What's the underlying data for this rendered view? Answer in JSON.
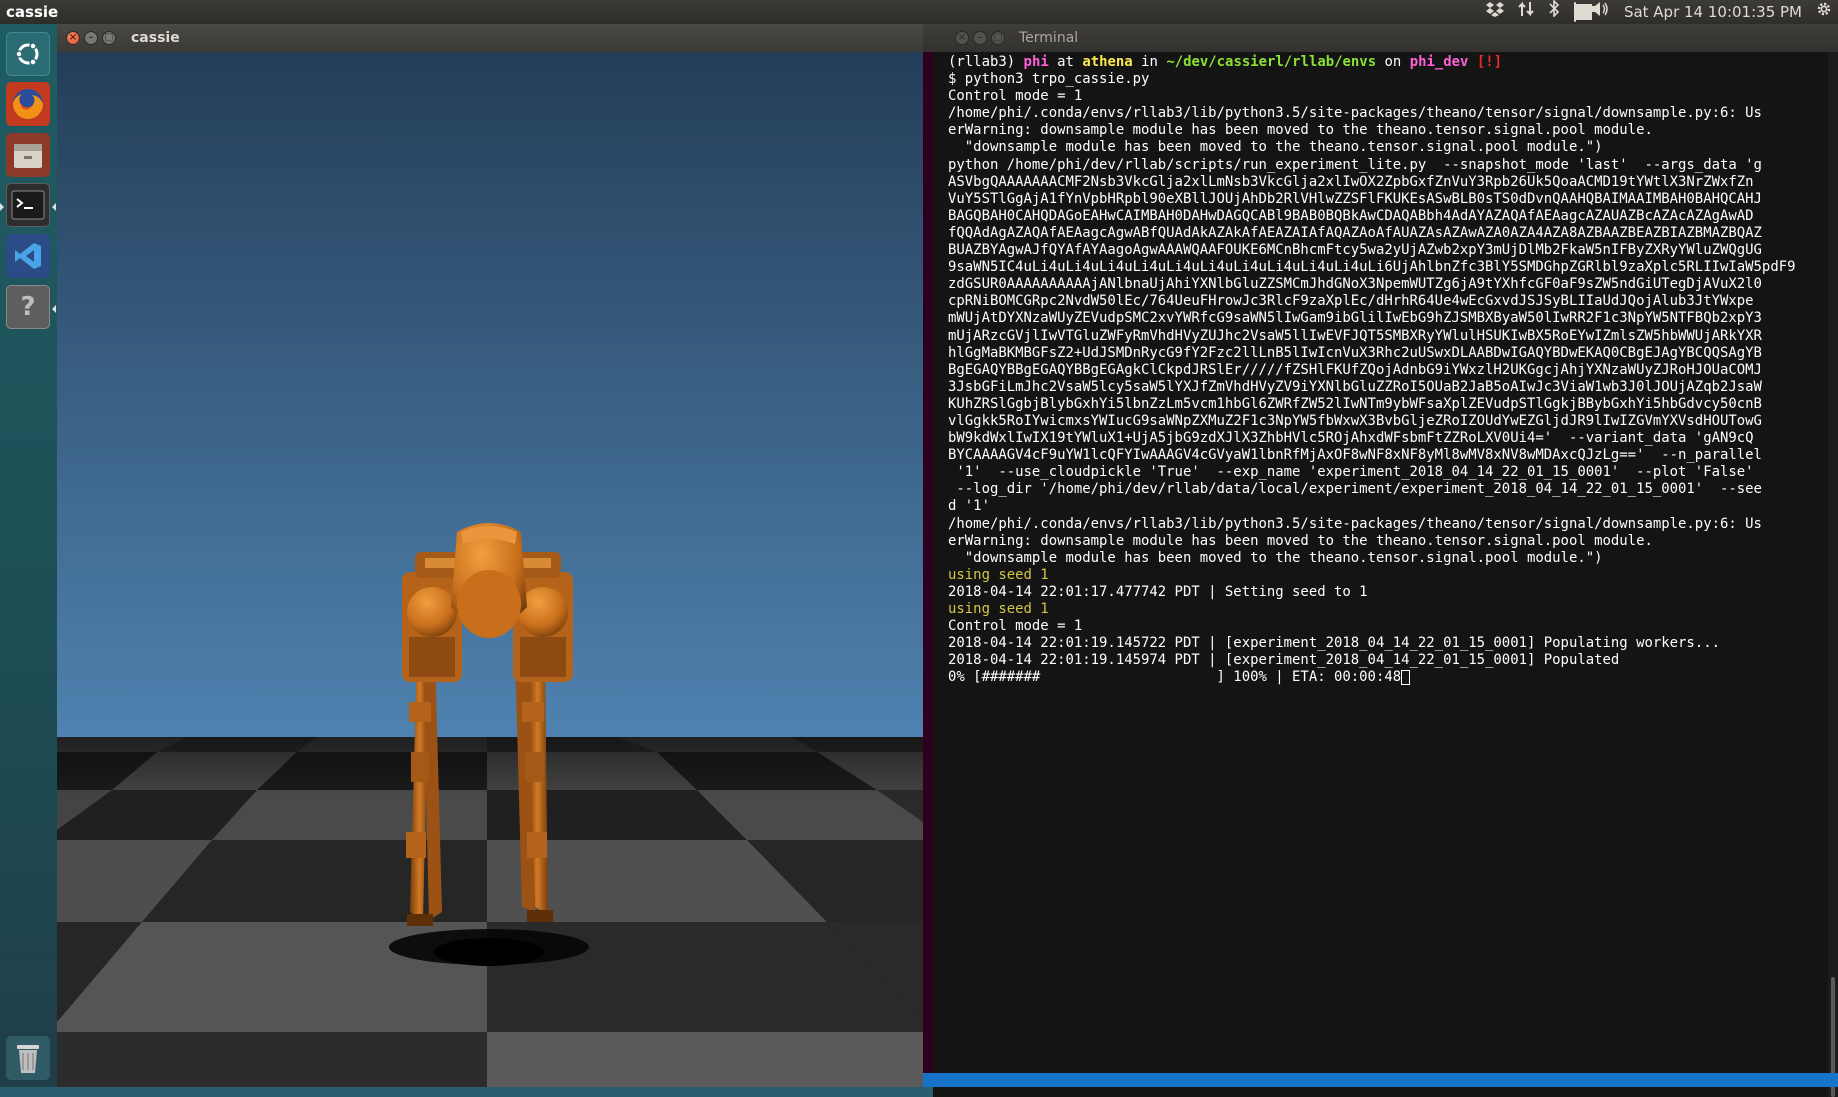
{
  "top_panel": {
    "app_name": "cassie",
    "clock": "Sat Apr 14 10:01:35 PM",
    "icons": [
      "dropbox-icon",
      "network-icon",
      "bluetooth-icon",
      "battery-icon",
      "volume-icon",
      "settings-gear-icon"
    ]
  },
  "launcher": {
    "items": [
      {
        "name": "ubuntu-dash-icon"
      },
      {
        "name": "firefox-icon"
      },
      {
        "name": "files-icon"
      },
      {
        "name": "terminal-icon"
      },
      {
        "name": "vscode-icon"
      },
      {
        "name": "help-icon"
      }
    ],
    "trash": "trash-icon"
  },
  "cassie_window": {
    "title": "cassie"
  },
  "terminal_window": {
    "title": "Terminal",
    "prompt": {
      "env": "(rllab3)",
      "user": "phi",
      "at": "at",
      "host": "athena",
      "in": "in",
      "path": "~/dev/cassierl/rllab/envs",
      "on": "on",
      "branch": "phi_dev",
      "status": "[!]"
    },
    "command": "$ python3 trpo_cassie.py",
    "lines": [
      {
        "text": "Control mode = 1",
        "style": "plain"
      },
      {
        "text": "/home/phi/.conda/envs/rllab3/lib/python3.5/site-packages/theano/tensor/signal/downsample.py:6: Us",
        "style": "plain"
      },
      {
        "text": "erWarning: downsample module has been moved to the theano.tensor.signal.pool module.",
        "style": "plain"
      },
      {
        "text": "  \"downsample module has been moved to the theano.tensor.signal.pool module.\")",
        "style": "plain"
      },
      {
        "text": "python /home/phi/dev/rllab/scripts/run_experiment_lite.py  --snapshot_mode 'last'  --args_data 'g",
        "style": "plain"
      },
      {
        "text": "ASVbgQAAAAAAACMF2Nsb3VkcGlja2xlLmNsb3VkcGlja2xlIwOX2ZpbGxfZnVuY3Rpb26Uk5QoaACMD19tYWtlX3NrZWxfZn",
        "style": "plain"
      },
      {
        "text": "VuY5STlGgAjA1fYnVpbHRpbl90eXBllJOUjAhDb2RlVHlwZZSFlFKUKEsASwBLB0sTS0dDvnQAAHQBAIMAAIMBAH0BAHQCAHJ",
        "style": "plain"
      },
      {
        "text": "BAGQBAH0CAHQDAGoEAHwCAIMBAH0DAHwDAGQCABl9BAB0BQBkAwCDAQABbh4AdAYAZAQAfAEAagcAZAUAZBcAZAcAZAgAwAD",
        "style": "plain"
      },
      {
        "text": "fQQAdAgAZAQAfAEAagcAgwABfQUAdAkAZAkAfAEAZAIAfAQAZAoAfAUAZAsAZAwAZA0AZA4AZA8AZBAAZBEAZBIAZBMAZBQAZ",
        "style": "plain"
      },
      {
        "text": "BUAZBYAgwAJfQYAfAYAagoAgwAAAWQAAFOUKE6MCnBhcmFtcy5wa2yUjAZwb2xpY3mUjDlMb2FkaW5nIFByZXRyYWluZWQgUG",
        "style": "plain"
      },
      {
        "text": "9saWN5IC4uLi4uLi4uLi4uLi4uLi4uLi4uLi4uLi4uLi4uLi4uLi6UjAhlbnZfc3BlY5SMDGhpZGRlbl9zaXplc5RLIIwIaW5pdF9",
        "style": "plain"
      },
      {
        "text": "zdGSUR0AAAAAAAAAAjANlbnaUjAhiYXNlbGluZZSMCmJhdGNoX3NpemWUTZg6jA9tYXhfcGF0aF9sZW5ndGiUTegDjAVuX2l0",
        "style": "plain"
      },
      {
        "text": "cpRNiBOMCGRpc2NvdW50lEc/764UeuFHrowJc3RlcF9zaXplEc/dHrhR64Ue4wEcGxvdJSJSyBLIIaUdJQojAlub3JtYWxpe",
        "style": "plain"
      },
      {
        "text": "mWUjAtDYXNzaWUyZEVudpSMC2xvYWRfcG9saWN5lIwGam9ibGlilIwEbG9hZJSMBXByaW50lIwRR2F1c3NpYW5NTFBQb2xpY3",
        "style": "plain"
      },
      {
        "text": "mUjARzcGVjlIwVTGluZWFyRmVhdHVyZUJhc2VsaW5llIwEVFJQT5SMBXRyYWlulHSUKIwBX5RoEYwIZmlsZW5hbWWUjARkYXR",
        "style": "plain"
      },
      {
        "text": "hlGgMaBKMBGFsZ2+UdJSMDnRycG9fY2Fzc2llLnB5lIwIcnVuX3Rhc2uUSwxDLAABDwIGAQYBDwEKAQ0CBgEJAgYBCQQSAgYB",
        "style": "plain"
      },
      {
        "text": "BgEGAQYBBgEGAQYBBgEGAgkClCkpdJRSlEr/////fZSHlFKUfZQojAdnbG9iYWxzlH2UKGgcjAhjYXNzaWUyZJRoHJOUaCOMJ",
        "style": "plain"
      },
      {
        "text": "3JsbGFiLmJhc2VsaW5lcy5saW5lYXJfZmVhdHVyZV9iYXNlbGluZZRoI5OUaB2JaB5oAIwJc3ViaW1wb3J0lJOUjAZqb2JsaW",
        "style": "plain"
      },
      {
        "text": "KUhZRSlGgbjBlybGxhYi5lbnZzLm5vcm1hbGl6ZWRfZW52lIwNTm9ybWFsaXplZEVudpSTlGgkjBBybGxhYi5hbGdvcy50cnB",
        "style": "plain"
      },
      {
        "text": "vlGgkk5RoIYwicmxsYWIucG9saWNpZXMuZ2F1c3NpYW5fbWxwX3BvbGljeZRoIZOUdYwEZGljdJR9lIwIZGVmYXVsdHOUTowG",
        "style": "plain"
      },
      {
        "text": "bW9kdWxlIwIX19tYWluX1+UjA5jbG9zdXJlX3ZhbHVlc5ROjAhxdWFsbmFtZZRoLXV0Ui4='  --variant_data 'gAN9cQ",
        "style": "plain"
      },
      {
        "text": "BYCAAAAGV4cF9uYW1lcQFYIwAAAGV4cGVyaW1lbnRfMjAxOF8wNF8xNF8yMl8wMV8xNV8wMDAxcQJzLg=='  --n_parallel",
        "style": "plain"
      },
      {
        "text": " '1'  --use_cloudpickle 'True'  --exp_name 'experiment_2018_04_14_22_01_15_0001'  --plot 'False'",
        "style": "plain"
      },
      {
        "text": " --log_dir '/home/phi/dev/rllab/data/local/experiment/experiment_2018_04_14_22_01_15_0001'  --see",
        "style": "plain"
      },
      {
        "text": "d '1'",
        "style": "plain"
      },
      {
        "text": "/home/phi/.conda/envs/rllab3/lib/python3.5/site-packages/theano/tensor/signal/downsample.py:6: Us",
        "style": "plain"
      },
      {
        "text": "erWarning: downsample module has been moved to the theano.tensor.signal.pool module.",
        "style": "plain"
      },
      {
        "text": "  \"downsample module has been moved to the theano.tensor.signal.pool module.\")",
        "style": "plain"
      },
      {
        "text": "using seed 1",
        "style": "gold"
      },
      {
        "text": "2018-04-14 22:01:17.477742 PDT | Setting seed to 1",
        "style": "plain"
      },
      {
        "text": "using seed 1",
        "style": "gold"
      },
      {
        "text": "Control mode = 1",
        "style": "plain"
      },
      {
        "text": "2018-04-14 22:01:19.145722 PDT | [experiment_2018_04_14_22_01_15_0001] Populating workers...",
        "style": "plain"
      },
      {
        "text": "2018-04-14 22:01:19.145974 PDT | [experiment_2018_04_14_22_01_15_0001] Populated",
        "style": "plain"
      },
      {
        "text": "0% [#######                     ] 100% | ETA: 00:00:48",
        "style": "plain"
      }
    ],
    "progress_fraction": 0.23
  },
  "colors": {
    "terminal_bg": "#141414",
    "sky_top": "#243e58",
    "sky_bottom": "#4f82b0",
    "robot": "#c96f1c",
    "launcher_bg": "#1f5d62",
    "accent_blue": "#1673c9"
  }
}
